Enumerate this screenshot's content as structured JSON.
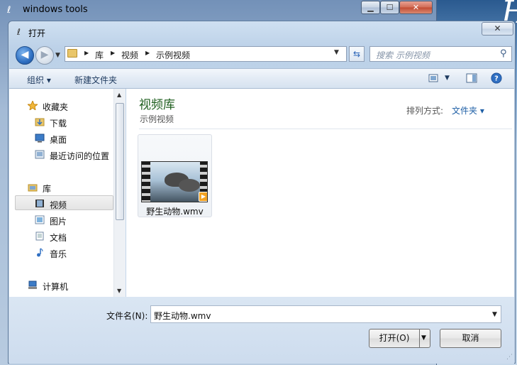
{
  "parent_window": {
    "title": "windows tools",
    "min_glyph": "▁",
    "max_glyph": "☐",
    "close_glyph": "✕"
  },
  "background_glyph": "H",
  "dialog": {
    "title": "打开",
    "close_glyph": "✕"
  },
  "nav": {
    "back_glyph": "◀",
    "forward_glyph": "▶",
    "breadcrumb": [
      "库",
      "视频",
      "示例视频"
    ],
    "search_placeholder": "搜索 示例视频"
  },
  "toolbar": {
    "organize_label": "组织 ▾",
    "new_folder_label": "新建文件夹"
  },
  "sidebar": {
    "favorites_label": "收藏夹",
    "favorites": [
      {
        "label": "下载",
        "icon": "download-folder-icon"
      },
      {
        "label": "桌面",
        "icon": "desktop-icon"
      },
      {
        "label": "最近访问的位置",
        "icon": "recent-places-icon"
      }
    ],
    "libraries_label": "库",
    "libraries": [
      {
        "label": "视频",
        "icon": "video-library-icon",
        "selected": true
      },
      {
        "label": "图片",
        "icon": "pictures-library-icon"
      },
      {
        "label": "文档",
        "icon": "documents-library-icon"
      },
      {
        "label": "音乐",
        "icon": "music-library-icon"
      }
    ],
    "computer_label": "计算机"
  },
  "main": {
    "library_title": "视频库",
    "library_subtitle": "示例视频",
    "arrange_label": "排列方式:",
    "arrange_value": "文件夹 ▾",
    "files": [
      {
        "name": "野生动物.wmv",
        "icon": "video-thumbnail"
      }
    ]
  },
  "footer": {
    "filename_label": "文件名(N):",
    "filename_value": "野生动物.wmv",
    "open_button": "打开(O)",
    "cancel_button": "取消"
  },
  "colors": {
    "accent": "#2f6fc2",
    "library_title": "#1e5e1e",
    "link": "#1e5fa6"
  }
}
